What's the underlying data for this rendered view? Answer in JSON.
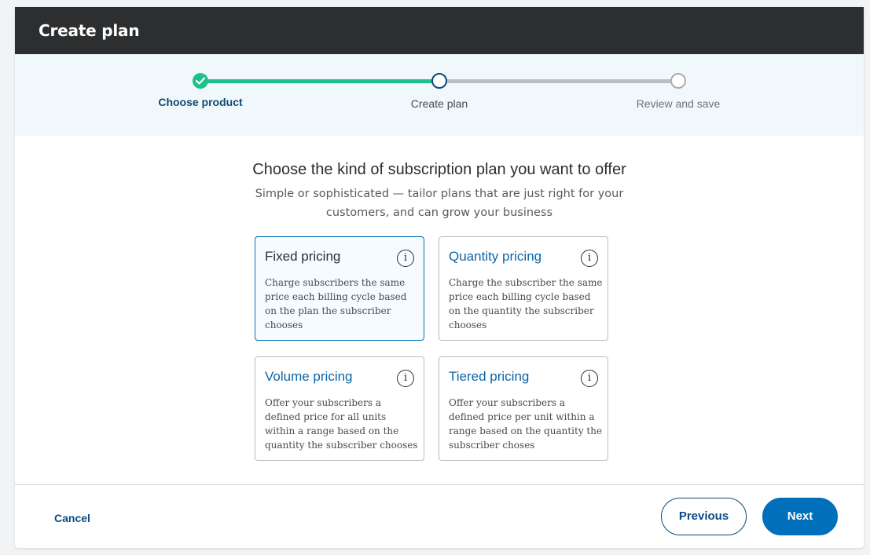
{
  "header": {
    "title": "Create plan"
  },
  "stepper": {
    "steps": [
      {
        "label": "Choose product",
        "state": "complete"
      },
      {
        "label": "Create plan",
        "state": "current"
      },
      {
        "label": "Review and save",
        "state": "upcoming"
      }
    ],
    "colors": {
      "complete": "#1ec18b",
      "current": "#0c4a72",
      "upcoming": "#bbbec1"
    }
  },
  "main": {
    "heading": "Choose the kind of subscription plan you want to offer",
    "subheading": "Simple or sophisticated — tailor plans that are just right for your customers, and can grow your business",
    "cards": [
      {
        "title": "Fixed pricing",
        "description": "Charge subscribers the same price each billing cycle based on the plan the subscriber chooses",
        "selected": true,
        "icon": "info-icon"
      },
      {
        "title": "Quantity pricing",
        "description": "Charge the subscriber the same price each billing cycle based on the quantity the subscriber chooses",
        "selected": false,
        "icon": "info-icon"
      },
      {
        "title": "Volume pricing",
        "description": "Offer your subscribers a defined price for all units within a range based on the quantity the subscriber chooses",
        "selected": false,
        "icon": "info-icon"
      },
      {
        "title": "Tiered pricing",
        "description": "Offer your subscribers a defined price per unit within a range based on the quantity the subscriber choses",
        "selected": false,
        "icon": "info-icon"
      }
    ]
  },
  "footer": {
    "cancel_label": "Cancel",
    "previous_label": "Previous",
    "next_label": "Next"
  },
  "colors": {
    "primary": "#0070ba",
    "header_bg": "#2c2e2f",
    "stepper_bg": "#f1f8fc"
  }
}
